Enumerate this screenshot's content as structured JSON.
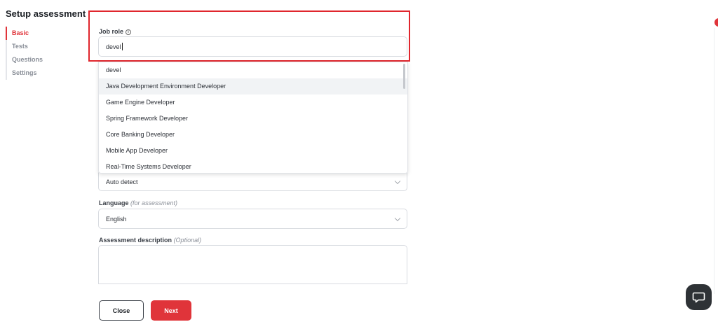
{
  "sidebar": {
    "title": "Setup assessment",
    "items": [
      {
        "label": "Basic",
        "active": true
      },
      {
        "label": "Tests",
        "active": false
      },
      {
        "label": "Questions",
        "active": false
      },
      {
        "label": "Settings",
        "active": false
      }
    ]
  },
  "job_role": {
    "label": "Job role",
    "value": "devel",
    "suggestions": [
      "devel",
      "Java Development Environment Developer",
      "Game Engine Developer",
      "Spring Framework Developer",
      "Core Banking Developer",
      "Mobile App Developer",
      "Real-Time Systems Developer"
    ]
  },
  "detect_field": {
    "value": "Auto detect"
  },
  "language": {
    "label": "Language",
    "hint": "(for assessment)",
    "value": "English"
  },
  "description": {
    "label": "Assessment description",
    "hint": "(Optional)",
    "value": ""
  },
  "buttons": {
    "close": "Close",
    "next": "Next"
  },
  "colors": {
    "accent": "#e0343a",
    "highlight": "#e0262d"
  },
  "icons": {
    "info": "info-icon",
    "chat": "chat-bubble-icon",
    "dropdown": "chevron-down-icon"
  }
}
